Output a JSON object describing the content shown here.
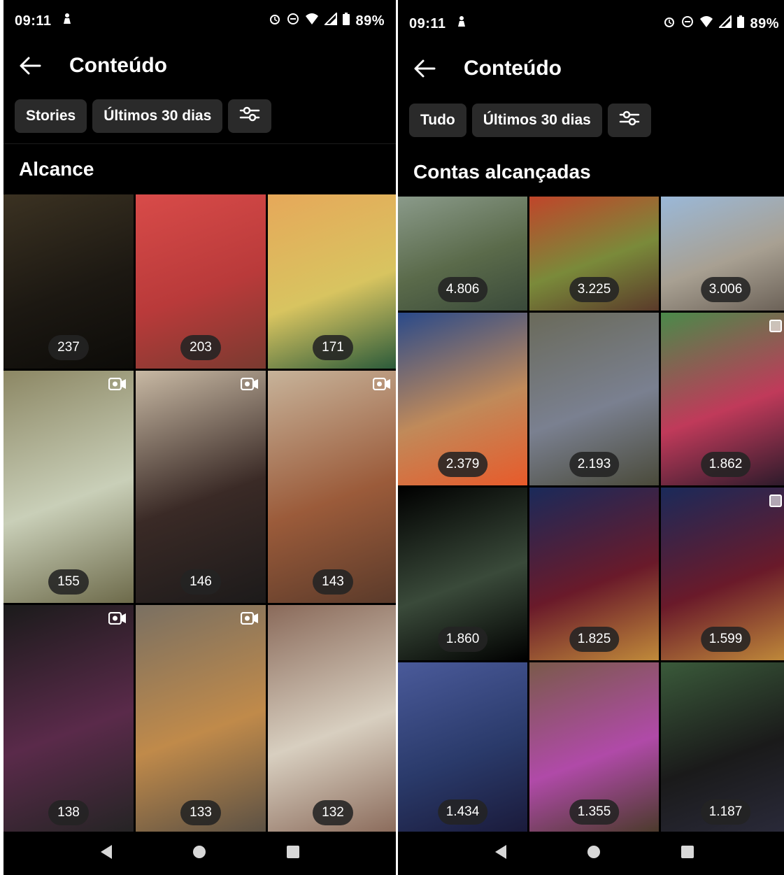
{
  "left": {
    "status": {
      "time": "09:11",
      "battery": "89%"
    },
    "header": {
      "title": "Conteúdo"
    },
    "filters": [
      "Stories",
      "Últimos 30 dias"
    ],
    "section_title": "Alcance",
    "tiles": [
      {
        "count": "237",
        "reel": false,
        "colors": [
          "#3b3222",
          "#1c1812",
          "#0c0b08"
        ]
      },
      {
        "count": "203",
        "reel": false,
        "colors": [
          "#d84b49",
          "#b93a3a",
          "#7a3a30"
        ]
      },
      {
        "count": "171",
        "reel": false,
        "colors": [
          "#e6a85a",
          "#d8c460",
          "#2a5a3a"
        ]
      },
      {
        "count": "155",
        "reel": true,
        "colors": [
          "#8c8764",
          "#c9cfb8",
          "#6d6a4a"
        ]
      },
      {
        "count": "146",
        "reel": true,
        "colors": [
          "#c8b9a4",
          "#3a2a26",
          "#1c1a1a"
        ]
      },
      {
        "count": "143",
        "reel": true,
        "colors": [
          "#c7b39a",
          "#9b5b3a",
          "#5a3a2a"
        ]
      },
      {
        "count": "138",
        "reel": true,
        "colors": [
          "#1b1b1b",
          "#5a2a4a",
          "#242424"
        ]
      },
      {
        "count": "133",
        "reel": true,
        "colors": [
          "#7a7062",
          "#c08a4a",
          "#5a5044"
        ]
      },
      {
        "count": "132",
        "reel": false,
        "colors": [
          "#8a6a5a",
          "#d8cfc0",
          "#8a6a5a"
        ]
      }
    ]
  },
  "right": {
    "status": {
      "time": "09:11",
      "battery": "89%"
    },
    "header": {
      "title": "Conteúdo"
    },
    "filters": [
      "Tudo",
      "Últimos 30 dias"
    ],
    "section_title": "Contas alcançadas",
    "tiles": [
      {
        "count": "4.806",
        "multi": false,
        "colors": [
          "#8a9a8a",
          "#5a6a4a",
          "#3a4a3a"
        ]
      },
      {
        "count": "3.225",
        "multi": false,
        "colors": [
          "#c0452a",
          "#7a8a3a",
          "#5a3a2a"
        ]
      },
      {
        "count": "3.006",
        "multi": false,
        "colors": [
          "#9ab8d8",
          "#a8a092",
          "#6a6056"
        ]
      },
      {
        "count": "2.379",
        "multi": false,
        "colors": [
          "#2a4a8a",
          "#c08a5a",
          "#e85a2a"
        ]
      },
      {
        "count": "2.193",
        "multi": false,
        "colors": [
          "#6a6a5a",
          "#7a8090",
          "#4a4a3a"
        ]
      },
      {
        "count": "1.862",
        "multi": true,
        "colors": [
          "#4a8a4a",
          "#c03a5a",
          "#2a1a2a"
        ]
      },
      {
        "count": "1.860",
        "multi": false,
        "colors": [
          "#000000",
          "#3a4a3a",
          "#000000"
        ]
      },
      {
        "count": "1.825",
        "multi": false,
        "colors": [
          "#1a2a5a",
          "#6a1a2a",
          "#c08a3a"
        ]
      },
      {
        "count": "1.599",
        "multi": true,
        "colors": [
          "#1a2a5a",
          "#6a1a2a",
          "#c08a3a"
        ]
      },
      {
        "count": "1.434",
        "multi": false,
        "colors": [
          "#4a5a9a",
          "#2a3a6a",
          "#1a1a3a"
        ]
      },
      {
        "count": "1.355",
        "multi": false,
        "colors": [
          "#7a5a4a",
          "#b04aa8",
          "#4a3a2a"
        ]
      },
      {
        "count": "1.187",
        "multi": false,
        "colors": [
          "#3a5a3a",
          "#1a1a1a",
          "#2a2a3a"
        ]
      }
    ]
  }
}
